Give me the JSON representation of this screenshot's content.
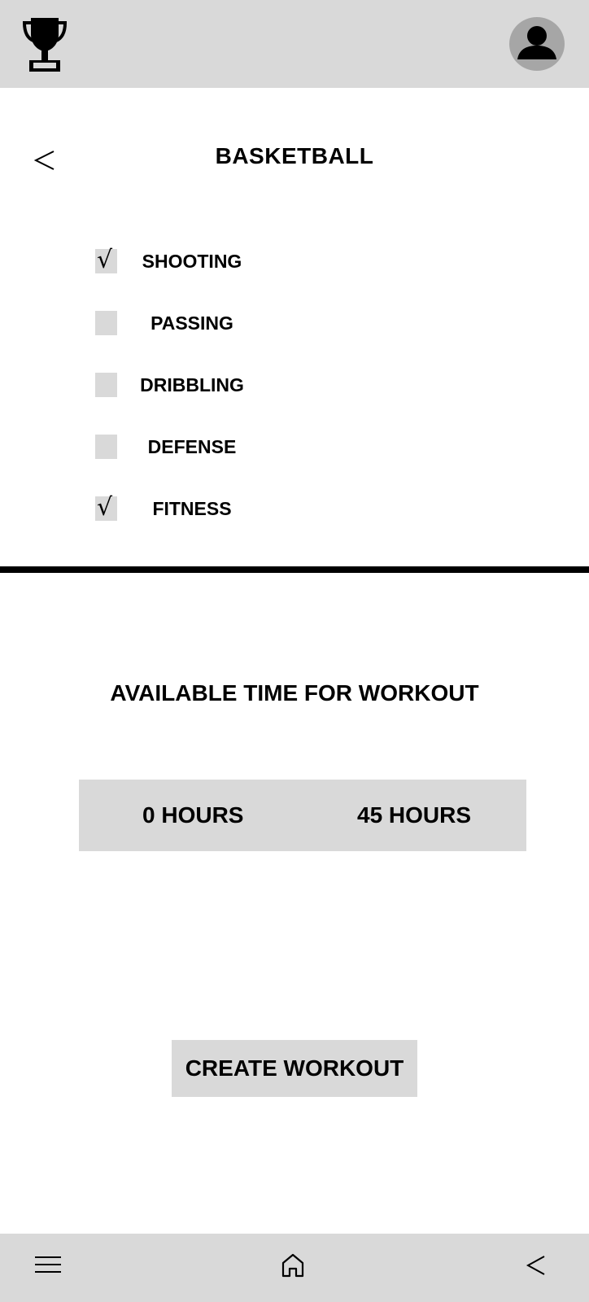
{
  "header": {
    "logo_icon": "trophy-icon",
    "profile_icon": "user-avatar-icon"
  },
  "page": {
    "back_icon": "chevron-left-icon",
    "title": "BASKETBALL"
  },
  "skills": [
    {
      "label": "SHOOTING",
      "checked": true
    },
    {
      "label": "PASSING",
      "checked": false
    },
    {
      "label": "DRIBBLING",
      "checked": false
    },
    {
      "label": "DEFENSE",
      "checked": false
    },
    {
      "label": "FITNESS",
      "checked": true
    }
  ],
  "check_glyph": "√",
  "time": {
    "heading": "AVAILABLE TIME FOR WORKOUT",
    "min_label": "0 HOURS",
    "max_label": "45 HOURS"
  },
  "actions": {
    "create_label": "CREATE WORKOUT"
  },
  "bottom_nav": {
    "menu_icon": "hamburger-menu-icon",
    "home_icon": "home-icon",
    "back_icon": "chevron-left-icon"
  },
  "colors": {
    "bar_bg": "#d9d9d9",
    "avatar_bg": "#a6a6a6",
    "text": "#000000"
  }
}
